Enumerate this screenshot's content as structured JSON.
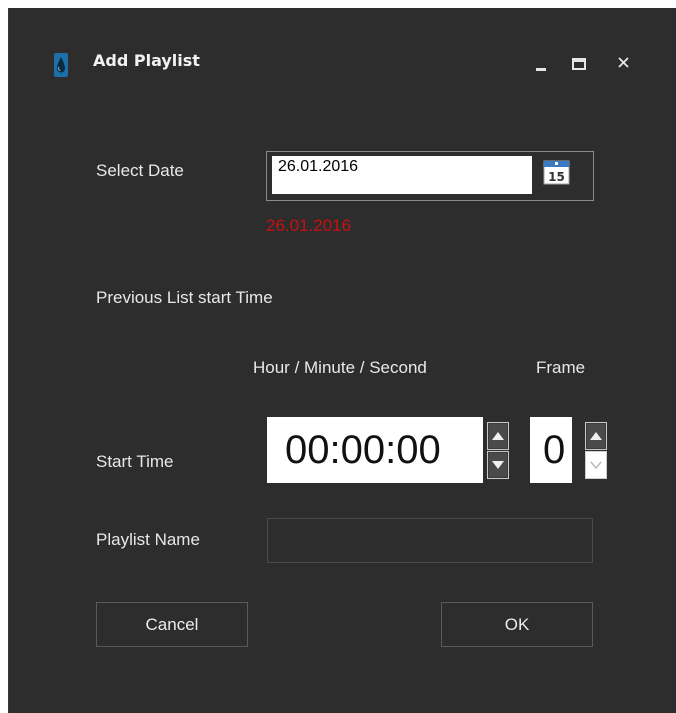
{
  "window": {
    "title": "Add Playlist",
    "controls": [
      "minimize-icon",
      "maximize-icon",
      "close-icon"
    ]
  },
  "form": {
    "select_date_label": "Select Date",
    "date_value": "26.01.2016",
    "calendar_day": "15",
    "date_echo": "26.01.2016",
    "previous_list_label": "Previous List start Time",
    "hms_header": "Hour / Minute / Second",
    "frame_header": "Frame",
    "start_time_label": "Start Time",
    "start_time_value": "00:00:00",
    "frame_value": "0",
    "playlist_name_label": "Playlist Name",
    "playlist_name_value": ""
  },
  "buttons": {
    "cancel": "Cancel",
    "ok": "OK"
  },
  "colors": {
    "background": "#2d2d2d",
    "text": "#e8e8e8",
    "date_echo": "#c81010"
  }
}
